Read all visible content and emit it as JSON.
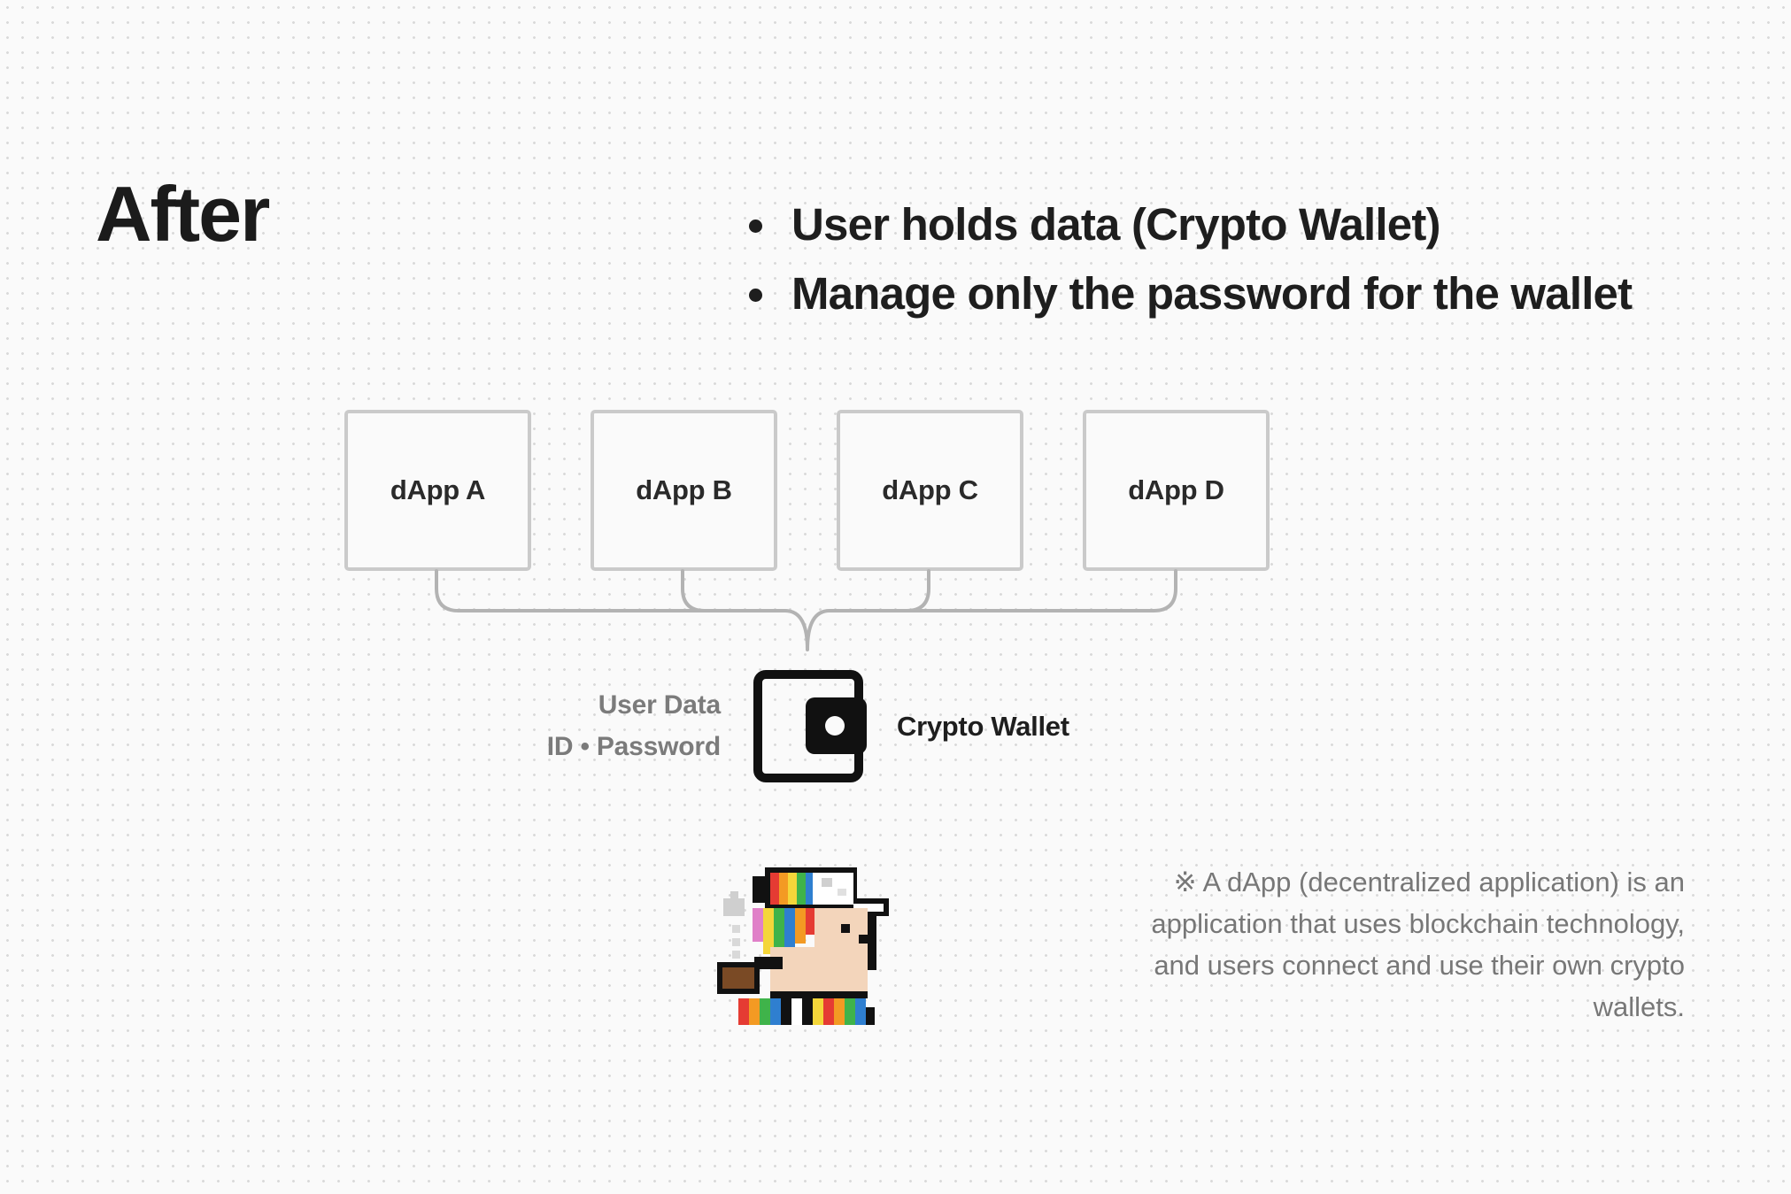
{
  "heading": "After",
  "bullets": [
    "User holds data (Crypto Wallet)",
    "Manage only the password for the wallet"
  ],
  "dapps": [
    "dApp A",
    "dApp B",
    "dApp C",
    "dApp D"
  ],
  "user_data": {
    "line1": "User Data",
    "line2": "ID • Password"
  },
  "wallet_label": "Crypto Wallet",
  "footnote": "※ A dApp (decentralized application) is an application that uses blockchain technology, and users connect and use their own crypto wallets.",
  "icons": {
    "wallet": "wallet-icon",
    "avatar": "pixel-art-character"
  },
  "colors": {
    "text_dark": "#1e1e1e",
    "text_gray": "#7b7b7b",
    "box_border": "#cacaca",
    "connector": "#b3b3b3",
    "background": "#fafafa"
  }
}
